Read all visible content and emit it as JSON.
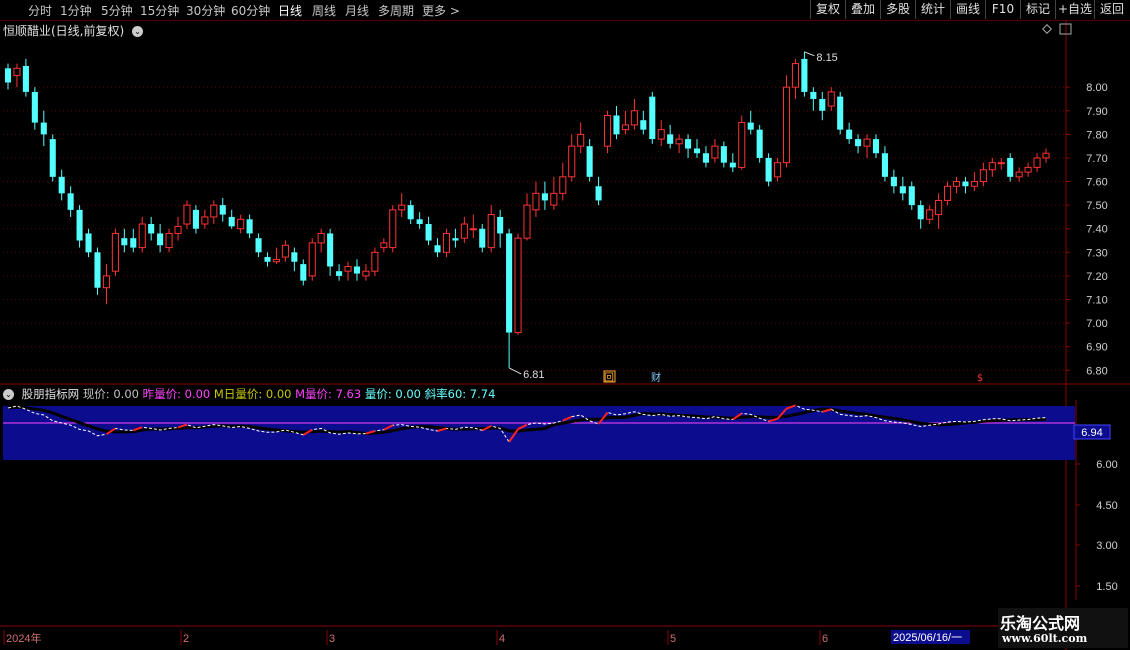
{
  "toolbar": {
    "periods": [
      "分时",
      "1分钟",
      "5分钟",
      "15分钟",
      "30分钟",
      "60分钟",
      "日线",
      "周线",
      "月线",
      "多周期",
      "更多 >"
    ],
    "active_period": "日线",
    "buttons": [
      "复权",
      "叠加",
      "多股",
      "统计",
      "画线",
      "F10",
      "标记",
      "+自选",
      "返回"
    ]
  },
  "stock": {
    "title": "恒顺醋业(日线,前复权)",
    "dropdown_icon": "chevron-down-icon"
  },
  "main_chart": {
    "y_ticks": [
      "8.00",
      "7.90",
      "7.80",
      "7.70",
      "7.60",
      "7.50",
      "7.40",
      "7.30",
      "7.20",
      "7.10",
      "7.00",
      "6.90",
      "6.80"
    ],
    "high_label": "8.15",
    "low_label": "6.81",
    "markers": [
      "回",
      "财",
      "$"
    ],
    "up_color": "#ff3333",
    "down_color": "#54ffff"
  },
  "indicator": {
    "name": "股朋指标网",
    "items": [
      {
        "label": "现价: 0.00",
        "color": "#c0c0c0"
      },
      {
        "label": "昨量价: 0.00",
        "color": "#ff44ff"
      },
      {
        "label": "M日量价: 0.00",
        "color": "#c8c800"
      },
      {
        "label": "M量价: 7.63",
        "color": "#ff44ff"
      },
      {
        "label": "量价: 0.00",
        "color": "#66ffff"
      },
      {
        "label": "斜率60: 7.74",
        "color": "#66ffff"
      }
    ],
    "y_ticks": [
      "6.00",
      "4.50",
      "3.00",
      "1.50"
    ],
    "value_tag": "6.94",
    "band_color": "#0c0c8e"
  },
  "time_axis": {
    "labels": [
      "2024年",
      "2",
      "3",
      "4",
      "5",
      "6"
    ],
    "current_date": "2025/06/16/一"
  },
  "watermark": {
    "line1": "乐淘公式网",
    "line2": "www.60lt.com"
  },
  "chart_data": {
    "type": "candlestick",
    "ylim": [
      6.78,
      8.2
    ],
    "candles": [
      [
        8.08,
        8.02,
        8.1,
        7.99
      ],
      [
        8.05,
        8.08,
        8.1,
        8.0
      ],
      [
        8.09,
        7.98,
        8.12,
        7.96
      ],
      [
        7.98,
        7.85,
        8.0,
        7.82
      ],
      [
        7.85,
        7.8,
        7.9,
        7.75
      ],
      [
        7.78,
        7.62,
        7.8,
        7.6
      ],
      [
        7.62,
        7.55,
        7.65,
        7.52
      ],
      [
        7.55,
        7.48,
        7.58,
        7.45
      ],
      [
        7.48,
        7.35,
        7.5,
        7.32
      ],
      [
        7.38,
        7.3,
        7.4,
        7.28
      ],
      [
        7.3,
        7.15,
        7.32,
        7.12
      ],
      [
        7.15,
        7.2,
        7.25,
        7.08
      ],
      [
        7.22,
        7.38,
        7.4,
        7.2
      ],
      [
        7.36,
        7.33,
        7.4,
        7.3
      ],
      [
        7.36,
        7.32,
        7.4,
        7.3
      ],
      [
        7.32,
        7.42,
        7.45,
        7.3
      ],
      [
        7.42,
        7.38,
        7.45,
        7.35
      ],
      [
        7.38,
        7.33,
        7.42,
        7.3
      ],
      [
        7.32,
        7.38,
        7.4,
        7.3
      ],
      [
        7.38,
        7.41,
        7.45,
        7.35
      ],
      [
        7.42,
        7.5,
        7.52,
        7.4
      ],
      [
        7.48,
        7.4,
        7.5,
        7.38
      ],
      [
        7.42,
        7.45,
        7.48,
        7.4
      ],
      [
        7.45,
        7.5,
        7.52,
        7.42
      ],
      [
        7.5,
        7.46,
        7.53,
        7.43
      ],
      [
        7.45,
        7.41,
        7.48,
        7.4
      ],
      [
        7.4,
        7.44,
        7.46,
        7.38
      ],
      [
        7.44,
        7.38,
        7.46,
        7.36
      ],
      [
        7.36,
        7.3,
        7.38,
        7.28
      ],
      [
        7.28,
        7.26,
        7.3,
        7.24
      ],
      [
        7.26,
        7.27,
        7.32,
        7.25
      ],
      [
        7.28,
        7.33,
        7.35,
        7.26
      ],
      [
        7.3,
        7.26,
        7.32,
        7.22
      ],
      [
        7.25,
        7.18,
        7.27,
        7.16
      ],
      [
        7.2,
        7.34,
        7.36,
        7.18
      ],
      [
        7.34,
        7.38,
        7.4,
        7.3
      ],
      [
        7.38,
        7.24,
        7.4,
        7.2
      ],
      [
        7.22,
        7.2,
        7.25,
        7.18
      ],
      [
        7.22,
        7.24,
        7.26,
        7.18
      ],
      [
        7.24,
        7.21,
        7.27,
        7.18
      ],
      [
        7.2,
        7.22,
        7.25,
        7.18
      ],
      [
        7.22,
        7.3,
        7.32,
        7.2
      ],
      [
        7.32,
        7.34,
        7.36,
        7.3
      ],
      [
        7.32,
        7.48,
        7.5,
        7.3
      ],
      [
        7.48,
        7.5,
        7.55,
        7.45
      ],
      [
        7.5,
        7.44,
        7.52,
        7.42
      ],
      [
        7.44,
        7.42,
        7.47,
        7.4
      ],
      [
        7.42,
        7.35,
        7.45,
        7.33
      ],
      [
        7.33,
        7.3,
        7.36,
        7.28
      ],
      [
        7.3,
        7.38,
        7.4,
        7.28
      ],
      [
        7.36,
        7.35,
        7.4,
        7.32
      ],
      [
        7.36,
        7.42,
        7.45,
        7.34
      ],
      [
        7.4,
        7.4,
        7.46,
        7.36
      ],
      [
        7.4,
        7.32,
        7.42,
        7.3
      ],
      [
        7.32,
        7.46,
        7.5,
        7.3
      ],
      [
        7.45,
        7.38,
        7.48,
        7.32
      ],
      [
        7.38,
        6.96,
        7.4,
        6.81
      ],
      [
        6.96,
        7.36,
        7.38,
        6.95
      ],
      [
        7.36,
        7.5,
        7.55,
        7.35
      ],
      [
        7.48,
        7.55,
        7.6,
        7.45
      ],
      [
        7.55,
        7.52,
        7.6,
        7.48
      ],
      [
        7.5,
        7.55,
        7.62,
        7.48
      ],
      [
        7.55,
        7.62,
        7.68,
        7.52
      ],
      [
        7.62,
        7.75,
        7.8,
        7.6
      ],
      [
        7.75,
        7.8,
        7.85,
        7.72
      ],
      [
        7.75,
        7.62,
        7.78,
        7.6
      ],
      [
        7.58,
        7.52,
        7.62,
        7.5
      ],
      [
        7.75,
        7.88,
        7.9,
        7.72
      ],
      [
        7.88,
        7.8,
        7.92,
        7.78
      ],
      [
        7.82,
        7.84,
        7.9,
        7.8
      ],
      [
        7.84,
        7.9,
        7.95,
        7.82
      ],
      [
        7.86,
        7.82,
        7.9,
        7.8
      ],
      [
        7.96,
        7.78,
        7.98,
        7.76
      ],
      [
        7.78,
        7.82,
        7.86,
        7.75
      ],
      [
        7.8,
        7.76,
        7.84,
        7.74
      ],
      [
        7.76,
        7.78,
        7.8,
        7.72
      ],
      [
        7.78,
        7.74,
        7.8,
        7.7
      ],
      [
        7.74,
        7.72,
        7.78,
        7.7
      ],
      [
        7.72,
        7.68,
        7.75,
        7.66
      ],
      [
        7.7,
        7.75,
        7.78,
        7.68
      ],
      [
        7.75,
        7.68,
        7.77,
        7.66
      ],
      [
        7.68,
        7.66,
        7.72,
        7.64
      ],
      [
        7.66,
        7.85,
        7.88,
        7.65
      ],
      [
        7.85,
        7.82,
        7.9,
        7.8
      ],
      [
        7.82,
        7.7,
        7.84,
        7.68
      ],
      [
        7.7,
        7.6,
        7.72,
        7.58
      ],
      [
        7.62,
        7.68,
        7.7,
        7.6
      ],
      [
        7.68,
        8.0,
        8.05,
        7.66
      ],
      [
        8.0,
        8.1,
        8.12,
        7.95
      ],
      [
        8.12,
        7.98,
        8.15,
        7.96
      ],
      [
        7.98,
        7.95,
        8.0,
        7.9
      ],
      [
        7.95,
        7.9,
        7.98,
        7.86
      ],
      [
        7.92,
        7.98,
        8.0,
        7.9
      ],
      [
        7.96,
        7.82,
        7.98,
        7.8
      ],
      [
        7.82,
        7.78,
        7.85,
        7.76
      ],
      [
        7.78,
        7.75,
        7.8,
        7.72
      ],
      [
        7.75,
        7.78,
        7.8,
        7.7
      ],
      [
        7.78,
        7.72,
        7.8,
        7.7
      ],
      [
        7.72,
        7.62,
        7.75,
        7.6
      ],
      [
        7.62,
        7.58,
        7.65,
        7.55
      ],
      [
        7.58,
        7.55,
        7.62,
        7.52
      ],
      [
        7.58,
        7.5,
        7.6,
        7.48
      ],
      [
        7.5,
        7.44,
        7.52,
        7.4
      ],
      [
        7.44,
        7.48,
        7.5,
        7.42
      ],
      [
        7.46,
        7.52,
        7.55,
        7.4
      ],
      [
        7.52,
        7.58,
        7.6,
        7.5
      ],
      [
        7.58,
        7.6,
        7.62,
        7.55
      ],
      [
        7.6,
        7.58,
        7.62,
        7.55
      ],
      [
        7.58,
        7.6,
        7.64,
        7.56
      ],
      [
        7.6,
        7.65,
        7.68,
        7.58
      ],
      [
        7.65,
        7.68,
        7.7,
        7.62
      ],
      [
        7.68,
        7.68,
        7.7,
        7.65
      ],
      [
        7.7,
        7.62,
        7.72,
        7.6
      ],
      [
        7.62,
        7.64,
        7.66,
        7.6
      ],
      [
        7.64,
        7.66,
        7.68,
        7.62
      ],
      [
        7.66,
        7.7,
        7.72,
        7.64
      ],
      [
        7.7,
        7.72,
        7.74,
        7.68
      ]
    ]
  }
}
